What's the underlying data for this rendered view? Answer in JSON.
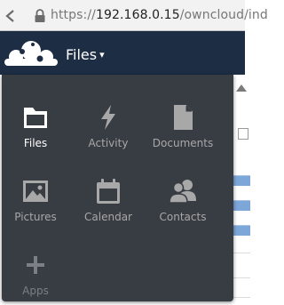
{
  "browser": {
    "url_scheme": "https://",
    "url_host": "192.168.0.15",
    "url_path": "/owncloud/ind"
  },
  "header": {
    "app_title": "Files",
    "caret": "▾"
  },
  "apps_menu": {
    "items": [
      {
        "label": "Files",
        "icon": "folder-icon",
        "active": true
      },
      {
        "label": "Activity",
        "icon": "lightning-icon",
        "active": false
      },
      {
        "label": "Documents",
        "icon": "document-icon",
        "active": false
      },
      {
        "label": "Pictures",
        "icon": "picture-icon",
        "active": false
      },
      {
        "label": "Calendar",
        "icon": "calendar-icon",
        "active": false
      },
      {
        "label": "Contacts",
        "icon": "contacts-icon",
        "active": false
      },
      {
        "label": "Apps",
        "icon": "plus-icon",
        "active": false
      }
    ]
  },
  "colors": {
    "header_bg": "#1d2d44",
    "menu_bg": "#383c43",
    "active_label": "#ffffff",
    "inactive_label": "#a8a8a8"
  }
}
